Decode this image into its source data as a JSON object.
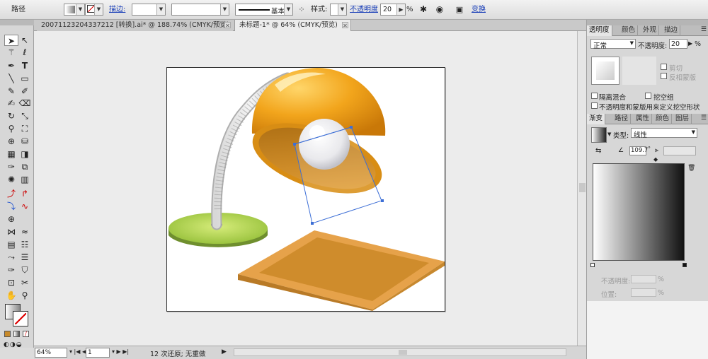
{
  "control_bar": {
    "object_type": "路径",
    "stroke_label": "描边:",
    "stroke_style": "基本",
    "style_label": "样式:",
    "opacity_label": "不透明度",
    "opacity_value": "20",
    "opacity_unit": "%",
    "transform_label": "变换"
  },
  "document_tabs": [
    {
      "title": "20071123204337212 [转换].ai* @ 188.74% (CMYK/预览)"
    },
    {
      "title": "未标题-1* @ 64% (CMYK/预览)"
    }
  ],
  "status_bar": {
    "zoom": "64%",
    "page": "1",
    "undo_text": "12 次还原; 无重做"
  },
  "transparency_panel": {
    "tabs": [
      "透明度",
      "颜色",
      "外观",
      "描边"
    ],
    "blend_mode": "正常",
    "opacity_label": "不透明度:",
    "opacity_value": "20",
    "opacity_unit": "%",
    "clip_label": "剪切",
    "invert_mask_label": "反相蒙版",
    "isolate_label": "隔离混合",
    "knockout_label": "挖空组",
    "define_knockout_label": "不透明度和蒙版用来定义挖空形状"
  },
  "gradient_panel": {
    "tabs": [
      "渐变",
      "路径",
      "属性",
      "颜色",
      "图层"
    ],
    "type_label": "类型:",
    "type_value": "线性",
    "angle_value": "109.7",
    "angle_unit": "°",
    "stop_opacity_label": "不透明度:",
    "stop_opacity_unit": "%",
    "location_label": "位置:",
    "location_unit": "%"
  },
  "colors": {
    "lamp_orange": "#f0a21c",
    "lamp_dark": "#d07e10",
    "base_green": "#9ac43a",
    "pad_orange": "#e8a33a",
    "selection_blue": "#3d6fd6"
  }
}
